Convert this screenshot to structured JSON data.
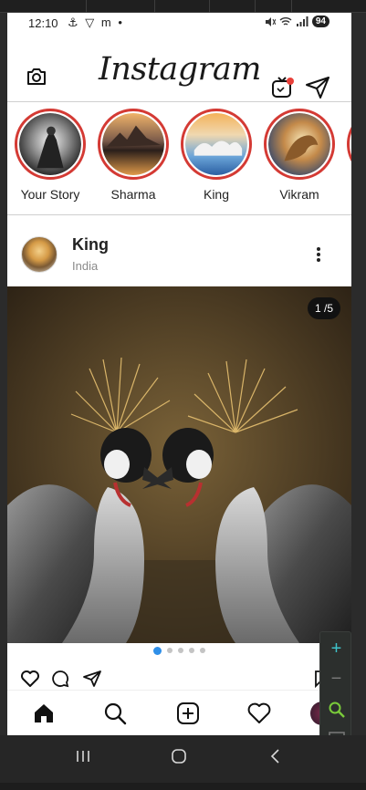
{
  "status": {
    "time": "12:10",
    "extras": "⚓ ▽ m •",
    "battery": "94"
  },
  "appbar": {
    "logo": "Instagram"
  },
  "stories": [
    {
      "name": "Your Story"
    },
    {
      "name": "Sharma"
    },
    {
      "name": "King"
    },
    {
      "name": "Vikram"
    }
  ],
  "post": {
    "username": "King",
    "location": "India",
    "counter": "1 /5"
  },
  "colors": {
    "story_ring": "#d43a34",
    "active_dot": "#2f8fe8",
    "emulator_accent": "#3ec2c9"
  },
  "icons": {
    "camera": "camera-icon",
    "igtv": "igtv-icon",
    "send": "send-icon",
    "more": "more-vertical-icon",
    "heart": "heart-icon",
    "comment": "comment-icon",
    "share": "send-icon",
    "home": "home-icon",
    "search": "search-icon",
    "add": "add-post-icon",
    "activity": "heart-icon"
  },
  "emulator_toolbar": [
    "+",
    "−",
    "zoom-icon",
    "screenshot-icon"
  ]
}
